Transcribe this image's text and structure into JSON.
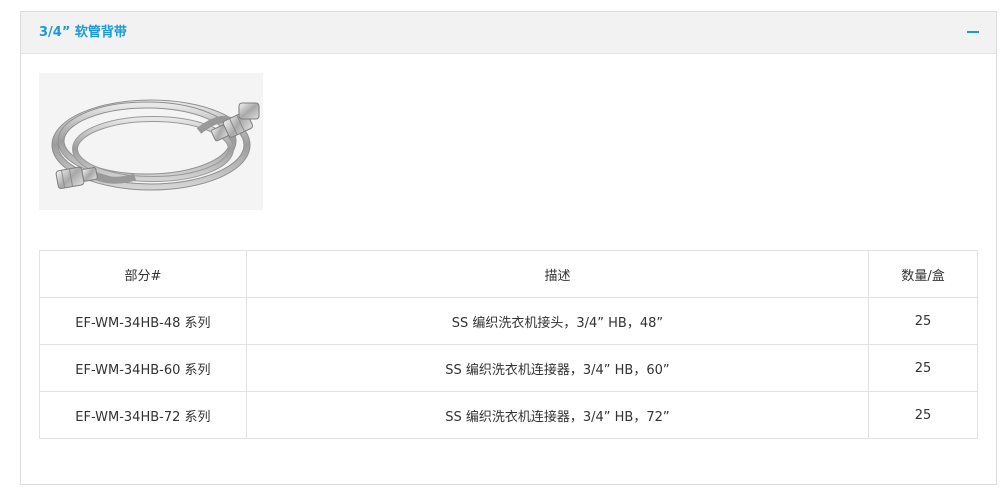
{
  "panel": {
    "title": "3/4” 软管背带",
    "collapse_icon": "minus-icon",
    "accent_color": "#1a9ad6"
  },
  "product_image": {
    "alt": "stainless-braided-hose-image"
  },
  "table": {
    "headers": {
      "part": "部分#",
      "description": "描述",
      "quantity": "数量/盒"
    },
    "rows": [
      {
        "part": "EF-WM-34HB-48 系列",
        "description": "SS 编织洗衣机接头，3/4” HB，48”",
        "quantity": "25"
      },
      {
        "part": "EF-WM-34HB-60 系列",
        "description": "SS 编织洗衣机连接器，3/4” HB，60”",
        "quantity": "25"
      },
      {
        "part": "EF-WM-34HB-72 系列",
        "description": "SS 编织洗衣机连接器，3/4” HB，72”",
        "quantity": "25"
      }
    ]
  }
}
